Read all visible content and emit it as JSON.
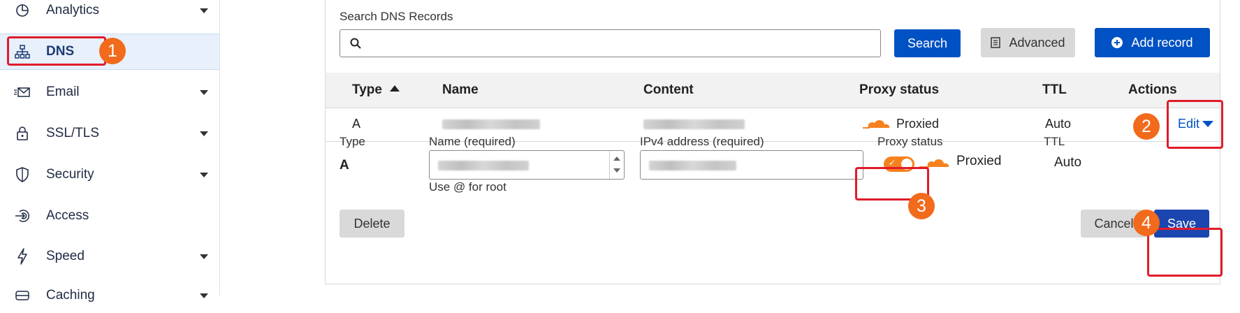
{
  "sidebar": {
    "items": [
      {
        "label": "Analytics",
        "icon": "pie-chart-icon",
        "caret": true
      },
      {
        "label": "DNS",
        "icon": "network-icon",
        "caret": false,
        "active": true
      },
      {
        "label": "Email",
        "icon": "email-icon",
        "caret": true
      },
      {
        "label": "SSL/TLS",
        "icon": "lock-icon",
        "caret": true
      },
      {
        "label": "Security",
        "icon": "shield-icon",
        "caret": true
      },
      {
        "label": "Access",
        "icon": "access-icon",
        "caret": false
      },
      {
        "label": "Speed",
        "icon": "lightning-icon",
        "caret": true
      },
      {
        "label": "Caching",
        "icon": "caching-icon",
        "caret": true
      }
    ]
  },
  "search": {
    "label": "Search DNS Records",
    "value": "",
    "button_label": "Search"
  },
  "toolbar": {
    "advanced_label": "Advanced",
    "add_record_label": "Add record"
  },
  "table": {
    "headers": [
      "Type",
      "Name",
      "Content",
      "Proxy status",
      "TTL",
      "Actions"
    ],
    "sort_indicator": "ascending",
    "rows": [
      {
        "type": "A",
        "name": "",
        "content": "",
        "proxy_status": "Proxied",
        "ttl": "Auto",
        "action": "Edit"
      }
    ]
  },
  "edit_form": {
    "type_label": "Type",
    "type_value": "A",
    "name_label": "Name (required)",
    "name_value": "",
    "name_hint": "Use @ for root",
    "ipv4_label": "IPv4 address (required)",
    "ipv4_value": "",
    "proxy_label": "Proxy status",
    "proxy_value": "Proxied",
    "proxy_on": true,
    "ttl_label": "TTL",
    "ttl_value": "Auto",
    "delete_label": "Delete",
    "cancel_label": "Cancel",
    "save_label": "Save"
  },
  "annotations": [
    "1",
    "2",
    "3",
    "4"
  ],
  "colors": {
    "brand_blue": "#0051c3",
    "cloudflare_orange": "#f6821f",
    "highlight_red": "#e01c2a",
    "badge_orange": "#f26a1b",
    "active_bg": "#e7f0fb"
  }
}
